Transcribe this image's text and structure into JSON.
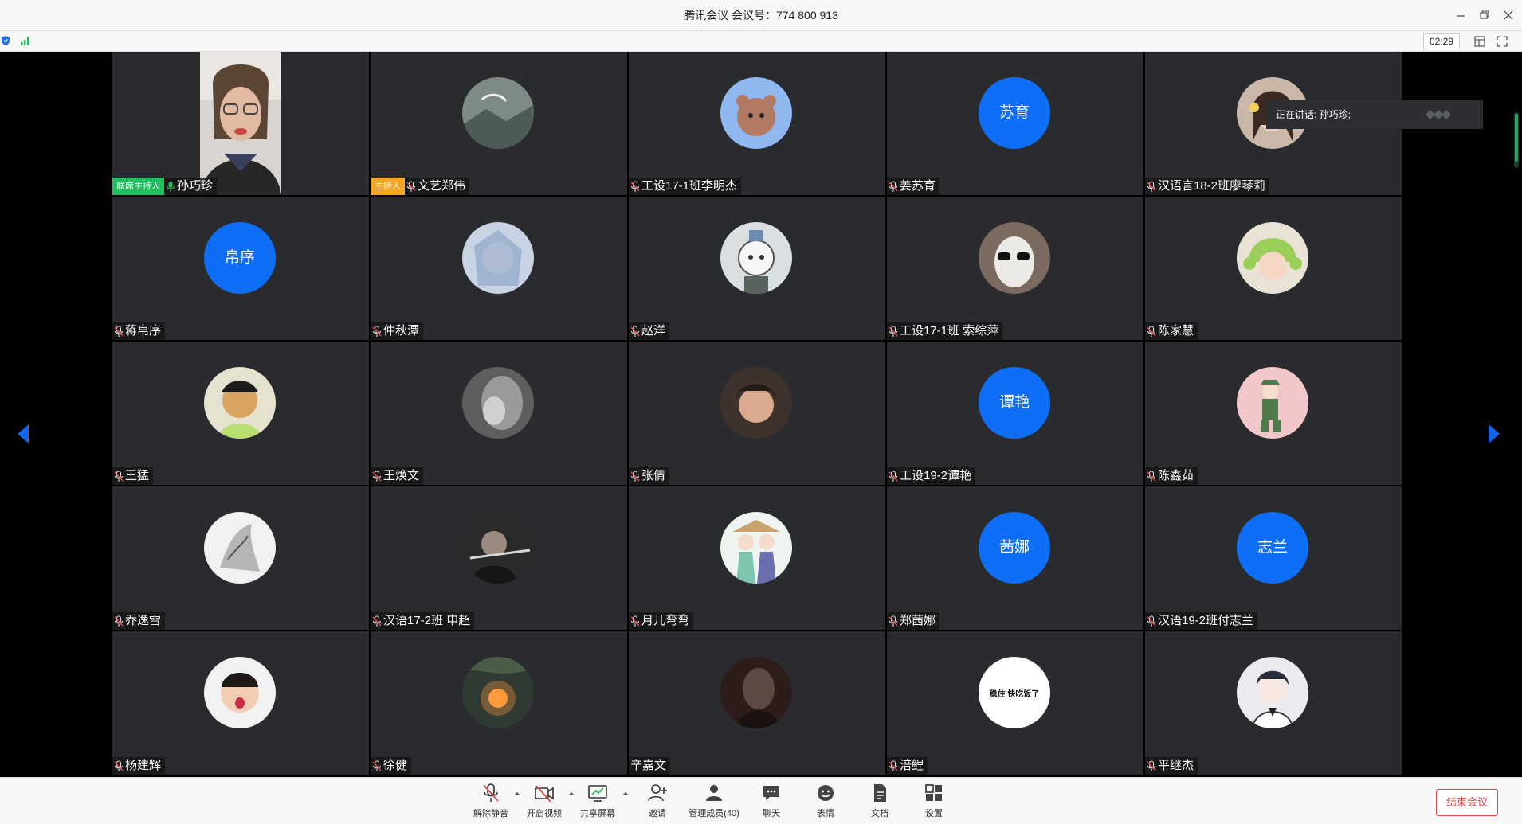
{
  "window": {
    "title": "腾讯会议 会议号：774 800 913"
  },
  "infobar": {
    "timer": "02:29"
  },
  "speaking": {
    "text": "正在讲话: 孙巧珍;"
  },
  "participants": [
    {
      "name": "孙巧珍",
      "role": "联席主持人",
      "avatar_type": "video",
      "mic": "on"
    },
    {
      "name": "文艺郑伟",
      "role": "主持人",
      "avatar_type": "image",
      "icon": "landscape-avatar"
    },
    {
      "name": "工设17-1班李明杰",
      "avatar_type": "image",
      "icon": "bear-avatar"
    },
    {
      "name": "姜苏育",
      "avatar_type": "text",
      "avatar_text": "苏育"
    },
    {
      "name": "汉语言18-2班廖琴莉",
      "avatar_type": "image",
      "icon": "girl-flower-avatar"
    },
    {
      "name": "蒋帛序",
      "avatar_type": "text",
      "avatar_text": "帛序"
    },
    {
      "name": "仲秋潭",
      "avatar_type": "image",
      "icon": "anime-girl-avatar"
    },
    {
      "name": "赵洋",
      "avatar_type": "image",
      "icon": "cartoon-bear-avatar"
    },
    {
      "name": "工设17-1班 索综萍",
      "avatar_type": "image",
      "icon": "sunglasses-avatar"
    },
    {
      "name": "陈家慧",
      "avatar_type": "image",
      "icon": "girl-green-hat-avatar"
    },
    {
      "name": "王猛",
      "avatar_type": "image",
      "icon": "cartoon-man-avatar"
    },
    {
      "name": "王焕文",
      "avatar_type": "image",
      "icon": "grey-photo-avatar"
    },
    {
      "name": "张倩",
      "avatar_type": "image",
      "icon": "child-photo-avatar"
    },
    {
      "name": "工设19-2谭艳",
      "avatar_type": "text",
      "avatar_text": "谭艳"
    },
    {
      "name": "陈鑫茹",
      "avatar_type": "image",
      "icon": "cartoon-soldier-avatar"
    },
    {
      "name": "乔逸雪",
      "avatar_type": "image",
      "icon": "sketch-avatar"
    },
    {
      "name": "汉语17-2班  申超",
      "avatar_type": "image",
      "icon": "flute-player-avatar"
    },
    {
      "name": "月儿弯弯",
      "avatar_type": "image",
      "icon": "couple-cartoon-avatar"
    },
    {
      "name": "郑茜娜",
      "avatar_type": "text",
      "avatar_text": "茜娜"
    },
    {
      "name": "汉语19-2班付志兰",
      "avatar_type": "text",
      "avatar_text": "志兰"
    },
    {
      "name": "杨建辉",
      "avatar_type": "image",
      "icon": "baby-photo-avatar"
    },
    {
      "name": "徐健",
      "avatar_type": "image",
      "icon": "sunset-avatar"
    },
    {
      "name": "辛嘉文",
      "avatar_type": "image",
      "icon": "dark-photo-avatar",
      "mic": "none"
    },
    {
      "name": "涪鲤",
      "avatar_type": "white-text",
      "avatar_text": "稳住 快吃饭了"
    },
    {
      "name": "平继杰",
      "avatar_type": "image",
      "icon": "anime-boy-avatar"
    }
  ],
  "toolbar": {
    "unmute": "解除静音",
    "video": "开启视频",
    "share": "共享屏幕",
    "invite": "邀请",
    "members": "管理成员(40)",
    "chat": "聊天",
    "reaction": "表情",
    "docs": "文档",
    "settings": "设置",
    "end": "结束会议"
  },
  "colors": {
    "text_avatar_bg": "#0e6ef5",
    "tile_bg": "#292b2e",
    "cohost_badge": "#1fbe5f",
    "host_badge": "#f5a623",
    "end_button": "#e04b4b"
  }
}
